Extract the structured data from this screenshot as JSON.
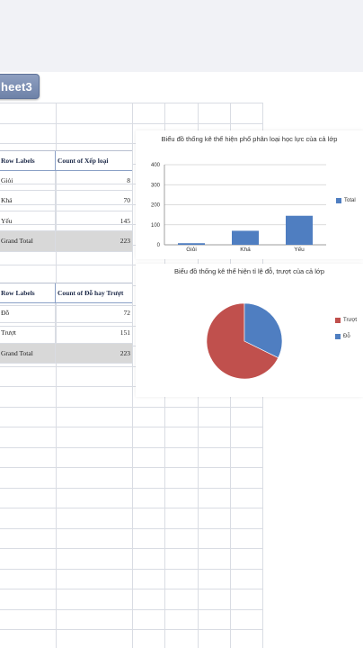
{
  "sheet_tab": {
    "label": "heet3"
  },
  "pivot1": {
    "header": [
      "Row Labels",
      "Count of Xếp loại"
    ],
    "rows": [
      {
        "label": "Giỏi",
        "value": "8"
      },
      {
        "label": "Khá",
        "value": "70"
      },
      {
        "label": "Yếu",
        "value": "145"
      }
    ],
    "total": {
      "label": "Grand Total",
      "value": "223"
    }
  },
  "pivot2": {
    "header": [
      "Row Labels",
      "Count of Đỗ hay Trượt"
    ],
    "rows": [
      {
        "label": "Đỗ",
        "value": "72"
      },
      {
        "label": "Trượt",
        "value": "151"
      }
    ],
    "total": {
      "label": "Grand Total",
      "value": "223"
    }
  },
  "colors": {
    "bar_blue": "#4f7ec1",
    "pie_red": "#c0504d",
    "pie_blue": "#4f7ec1"
  },
  "chart_data": [
    {
      "type": "bar",
      "title": "Biểu đồ thống kê thể hiện phổ phân loại học lực của cả lớp",
      "categories": [
        "Giỏi",
        "Khá",
        "Yếu"
      ],
      "series": [
        {
          "name": "Total",
          "values": [
            8,
            70,
            145
          ]
        }
      ],
      "yticks": [
        "0",
        "100",
        "200",
        "300",
        "400"
      ],
      "ylim": [
        0,
        400
      ],
      "legend": "right",
      "grid": true
    },
    {
      "type": "pie",
      "title": "Biểu đồ thống kê thể hiện tỉ lệ đỗ, trượt của cả lớp",
      "slices": [
        {
          "name": "Trượt",
          "value": 151
        },
        {
          "name": "Đỗ",
          "value": 72
        }
      ],
      "legend": "right"
    }
  ]
}
